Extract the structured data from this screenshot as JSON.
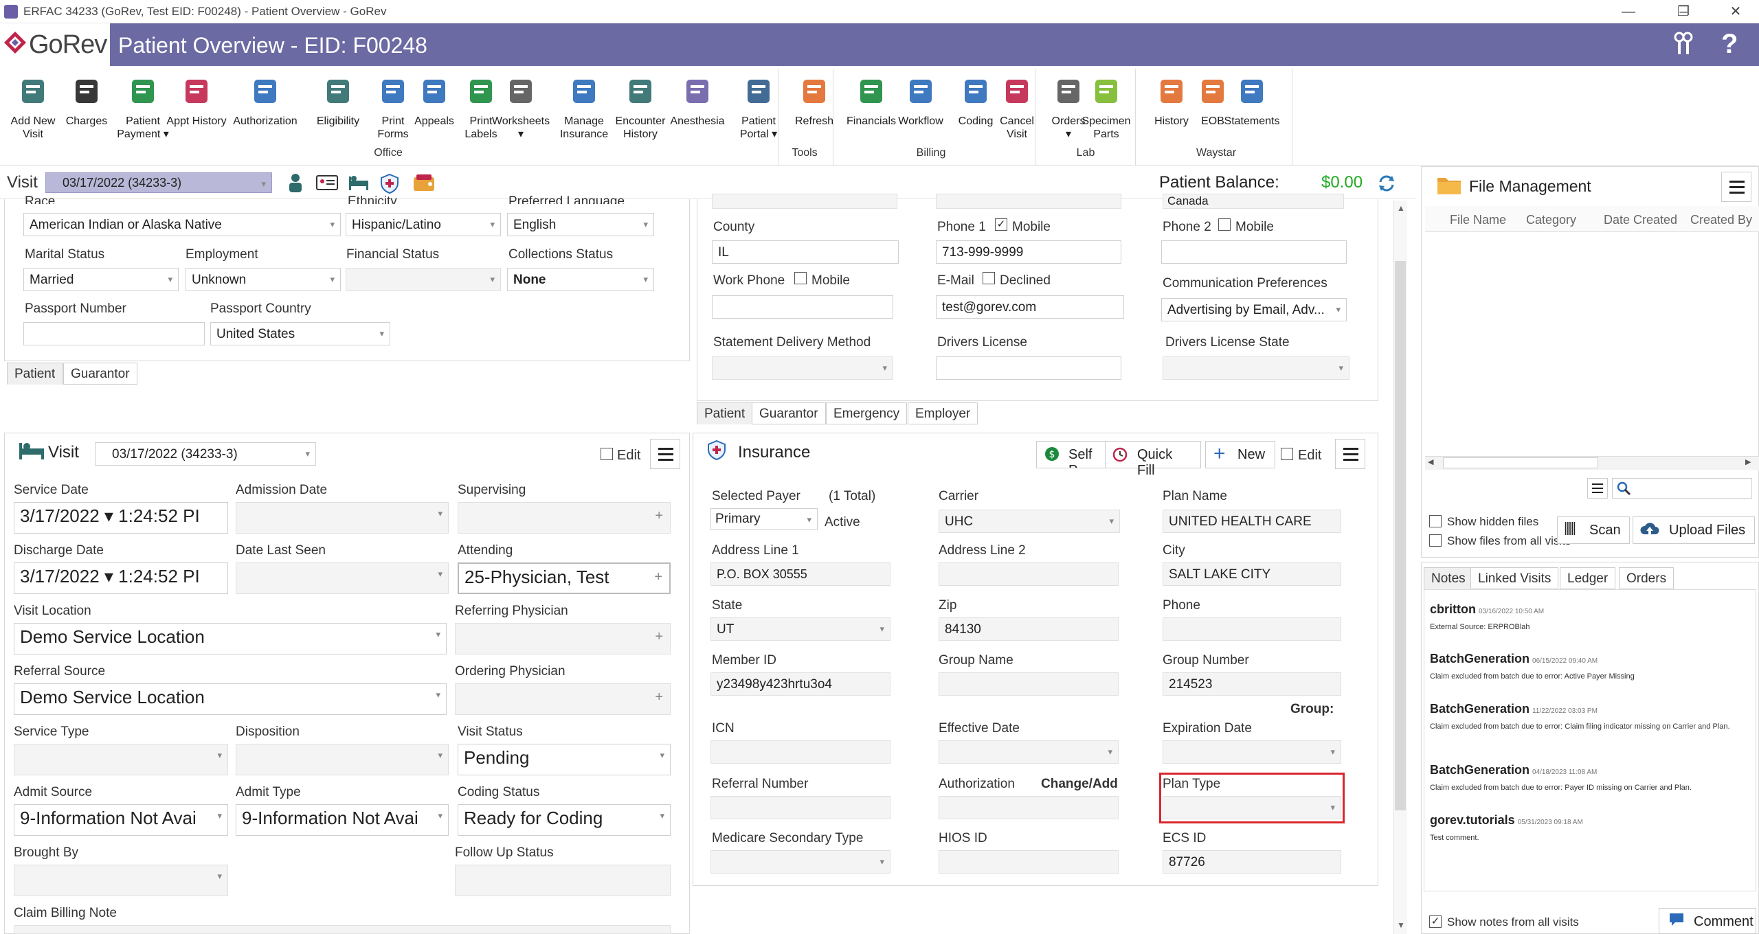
{
  "window": {
    "title": "ERFAC 34233 (GoRev, Test EID: F00248) - Patient Overview - GoRev"
  },
  "header": {
    "logo": "GoRev",
    "page_title": "Patient Overview - EID: F00248",
    "accent": "#6b6aa3"
  },
  "ribbon": {
    "buttons": [
      {
        "label1": "Add New",
        "label2": "Visit",
        "icon": "bed-plus-icon"
      },
      {
        "label1": "Charges",
        "label2": "",
        "icon": "barcode-icon"
      },
      {
        "label1": "Patient",
        "label2": "Payment ▾",
        "icon": "cash-hand-icon"
      },
      {
        "label1": "Appt History",
        "label2": "",
        "icon": "calendar-icon"
      },
      {
        "label1": "Authorization",
        "label2": "",
        "icon": "shield-check-icon"
      },
      {
        "label1": "Eligibility",
        "label2": "",
        "icon": "person-check-icon"
      },
      {
        "label1": "Print",
        "label2": "Forms",
        "icon": "printer-icon"
      },
      {
        "label1": "Appeals",
        "label2": "",
        "icon": "documents-icon"
      },
      {
        "label1": "Print",
        "label2": "Labels",
        "icon": "tag-icon"
      },
      {
        "label1": "Worksheets",
        "label2": "▾",
        "icon": "worksheet-icon"
      },
      {
        "label1": "Manage",
        "label2": "Insurance",
        "icon": "insurance-shield-icon"
      },
      {
        "label1": "Encounter",
        "label2": "History",
        "icon": "encounter-calendar-icon"
      },
      {
        "label1": "Anesthesia",
        "label2": "",
        "icon": "syringe-icon"
      },
      {
        "label1": "Patient",
        "label2": "Portal ▾",
        "icon": "portal-gear-icon"
      },
      {
        "label1": "Refresh",
        "label2": "",
        "icon": "refresh-icon"
      },
      {
        "label1": "Financials",
        "label2": "",
        "icon": "dollar-icon"
      },
      {
        "label1": "Workflow",
        "label2": "",
        "icon": "clipboard-icon"
      },
      {
        "label1": "Coding",
        "label2": "",
        "icon": "book-icon"
      },
      {
        "label1": "Cancel",
        "label2": "Visit",
        "icon": "cancel-clock-icon"
      },
      {
        "label1": "Orders",
        "label2": "▾",
        "icon": "orders-icon"
      },
      {
        "label1": "Specimen",
        "label2": "Parts",
        "icon": "specimen-icon"
      },
      {
        "label1": "History",
        "label2": "",
        "icon": "clock-icon"
      },
      {
        "label1": "EOB",
        "label2": "",
        "icon": "eob-icon"
      },
      {
        "label1": "Statements",
        "label2": "",
        "icon": "statement-info-icon"
      }
    ],
    "groups": {
      "office": "Office",
      "tools": "Tools",
      "billing": "Billing",
      "lab": "Lab",
      "waystar": "Waystar"
    }
  },
  "visit_bar": {
    "label": "Visit",
    "value": "03/17/2022 (34233-3)",
    "balance_label": "Patient Balance:",
    "balance_value": "$0.00"
  },
  "patient_panel": {
    "race_label": "Race",
    "race": "American Indian or Alaska Native",
    "ethnicity_label": "Ethnicity",
    "ethnicity": "Hispanic/Latino",
    "language_label": "Preferred Language",
    "language": "English",
    "marital_label": "Marital Status",
    "marital": "Married",
    "employment_label": "Employment",
    "employment": "Unknown",
    "financial_label": "Financial Status",
    "financial": "",
    "collections_label": "Collections Status",
    "collections": "None",
    "passport_label": "Passport Number",
    "passport": "",
    "passport_country_label": "Passport Country",
    "passport_country": "United States",
    "tabs": [
      "Patient",
      "Guarantor"
    ]
  },
  "contact_panel": {
    "county_label": "County",
    "county": "IL",
    "phone1_label": "Phone 1",
    "phone1": "713-999-9999",
    "mobile": "Mobile",
    "phone2_label": "Phone 2",
    "work_label": "Work Phone",
    "email_label": "E-Mail",
    "declined": "Declined",
    "email": "test@gorev.com",
    "comm_label": "Communication Preferences",
    "comm": "Advertising by Email, Adv...",
    "stmt_label": "Statement Delivery Method",
    "dl_label": "Drivers License",
    "dl_state_label": "Drivers License State",
    "partial_top": "Canada",
    "tabs": [
      "Patient",
      "Guarantor",
      "Emergency",
      "Employer"
    ]
  },
  "visit_panel": {
    "title": "Visit",
    "visit": "03/17/2022 (34233-3)",
    "edit": "Edit",
    "service_date_label": "Service Date",
    "service_date": "3/17/2022 ▾ 1:24:52 PI",
    "admission_label": "Admission Date",
    "supervising_label": "Supervising",
    "discharge_label": "Discharge Date",
    "discharge_date": "3/17/2022 ▾ 1:24:52 PI",
    "last_seen_label": "Date Last Seen",
    "attending_label": "Attending",
    "attending": "25-Physician, Test",
    "location_label": "Visit Location",
    "location": "Demo Service Location",
    "referring_label": "Referring Physician",
    "ref_source_label": "Referral Source",
    "ref_source": "Demo Service Location",
    "ordering_label": "Ordering Physician",
    "service_type_label": "Service Type",
    "disposition_label": "Disposition",
    "status_label": "Visit Status",
    "status": "Pending",
    "admit_source_label": "Admit Source",
    "admit_source": "9-Information Not Avai",
    "admit_type_label": "Admit Type",
    "admit_type": "9-Information Not Avai",
    "coding_label": "Coding Status",
    "coding": "Ready for Coding",
    "brought_label": "Brought By",
    "followup_label": "Follow Up Status",
    "billing_note_label": "Claim Billing Note"
  },
  "insurance_panel": {
    "title": "Insurance",
    "self_pay": "Self P",
    "quick_fill": "Quick Fill",
    "new": "New",
    "edit": "Edit",
    "payer_label": "Selected Payer",
    "total": "(1 Total)",
    "payer": "Primary",
    "active": "Active",
    "carrier_label": "Carrier",
    "carrier": "UHC",
    "plan_label": "Plan Name",
    "plan": "UNITED HEALTH CARE",
    "addr1_label": "Address Line 1",
    "addr1": "P.O. BOX 30555",
    "addr2_label": "Address Line 2",
    "city_label": "City",
    "city": "SALT LAKE CITY",
    "state_label": "State",
    "state": "UT",
    "zip_label": "Zip",
    "zip": "84130",
    "phone_label": "Phone",
    "member_label": "Member ID",
    "member": "y23498y423hrtu3o4",
    "group_name_label": "Group Name",
    "group_num_label": "Group Number",
    "group_num": "214523",
    "group_extra": "Group:",
    "icn_label": "ICN",
    "effective_label": "Effective Date",
    "expiration_label": "Expiration Date",
    "referral_label": "Referral Number",
    "auth_label": "Authorization",
    "change_add": "Change/Add",
    "plan_type_label": "Plan Type",
    "msp_label": "Medicare Secondary Type",
    "hios_label": "HIOS ID",
    "ecs_label": "ECS ID",
    "ecs": "87726"
  },
  "file_mgmt": {
    "title": "File Management",
    "columns": [
      "File Name",
      "Category",
      "Date Created",
      "Created By"
    ],
    "show_hidden": "Show hidden files",
    "show_all": "Show files from all visits",
    "scan": "Scan",
    "upload": "Upload Files"
  },
  "notes": {
    "tabs": [
      "Notes",
      "Linked Visits",
      "Ledger",
      "Orders"
    ],
    "items": [
      {
        "user": "cbritton",
        "time": "03/16/2022 10:50 AM",
        "body": "External Source: ERPROBlah"
      },
      {
        "user": "BatchGeneration",
        "time": "06/15/2022 09:40 AM",
        "body": "Claim excluded from batch due to error: Active Payer Missing"
      },
      {
        "user": "BatchGeneration",
        "time": "11/22/2022 03:03 PM",
        "body": "Claim excluded from batch due to error: Claim filing indicator missing on Carrier and Plan."
      },
      {
        "user": "BatchGeneration",
        "time": "04/18/2023 11:08 AM",
        "body": "Claim excluded from batch due to error: Payer ID missing on Carrier and Plan."
      },
      {
        "user": "gorev.tutorials",
        "time": "05/31/2023 09:18 AM",
        "body": "Test comment."
      }
    ],
    "show_all": "Show notes from all visits",
    "comment": "Comment"
  }
}
